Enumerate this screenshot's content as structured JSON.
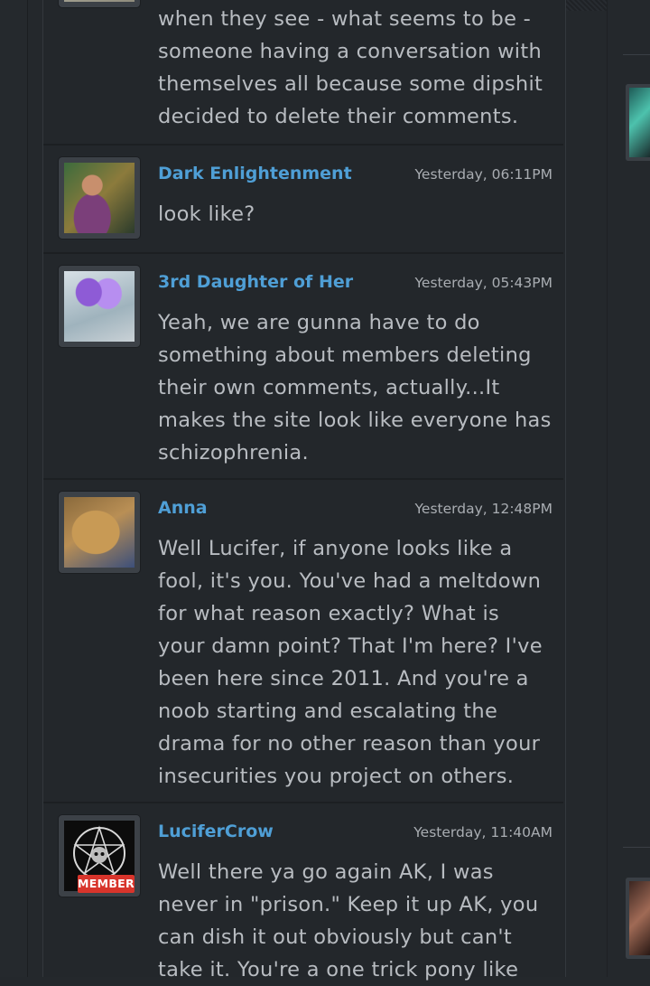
{
  "comments": [
    {
      "author": "",
      "timestamp": "",
      "lines": [
        "when they see - what seems to be -",
        "someone having a conversation with",
        "themselves all because some dipshit",
        "decided to delete their comments."
      ]
    },
    {
      "author": "Dark Enlightenment",
      "timestamp": "Yesterday, 06:11PM",
      "lines": [
        "look like?"
      ]
    },
    {
      "author": "3rd Daughter of Her",
      "timestamp": "Yesterday, 05:43PM",
      "lines": [
        "Yeah, we are gunna have to do",
        "something about members deleting",
        "their own comments, actually...It",
        "makes the site look like everyone has",
        "schizophrenia."
      ]
    },
    {
      "author": "Anna",
      "timestamp": "Yesterday, 12:48PM",
      "lines": [
        "Well Lucifer, if anyone looks like a",
        "fool, it's you. You've had a meltdown",
        "for what reason exactly? What is",
        "your damn point? That I'm here? I've",
        "been here since 2011. And you're a",
        "noob starting and escalating the",
        "drama for no other reason than your",
        "insecurities you project on others."
      ]
    },
    {
      "author": "LuciferCrow",
      "timestamp": "Yesterday, 11:40AM",
      "badge": "MEMBER",
      "lines": [
        "Well there ya go again AK, I was",
        "never in \"prison.\" Keep it up AK, you",
        "can dish it out obviously but can't",
        "take it. You're a one trick pony like"
      ]
    }
  ],
  "colors": {
    "author_link": "#4f9fd6",
    "badge_red": "#d8342b",
    "background": "#24282c"
  }
}
